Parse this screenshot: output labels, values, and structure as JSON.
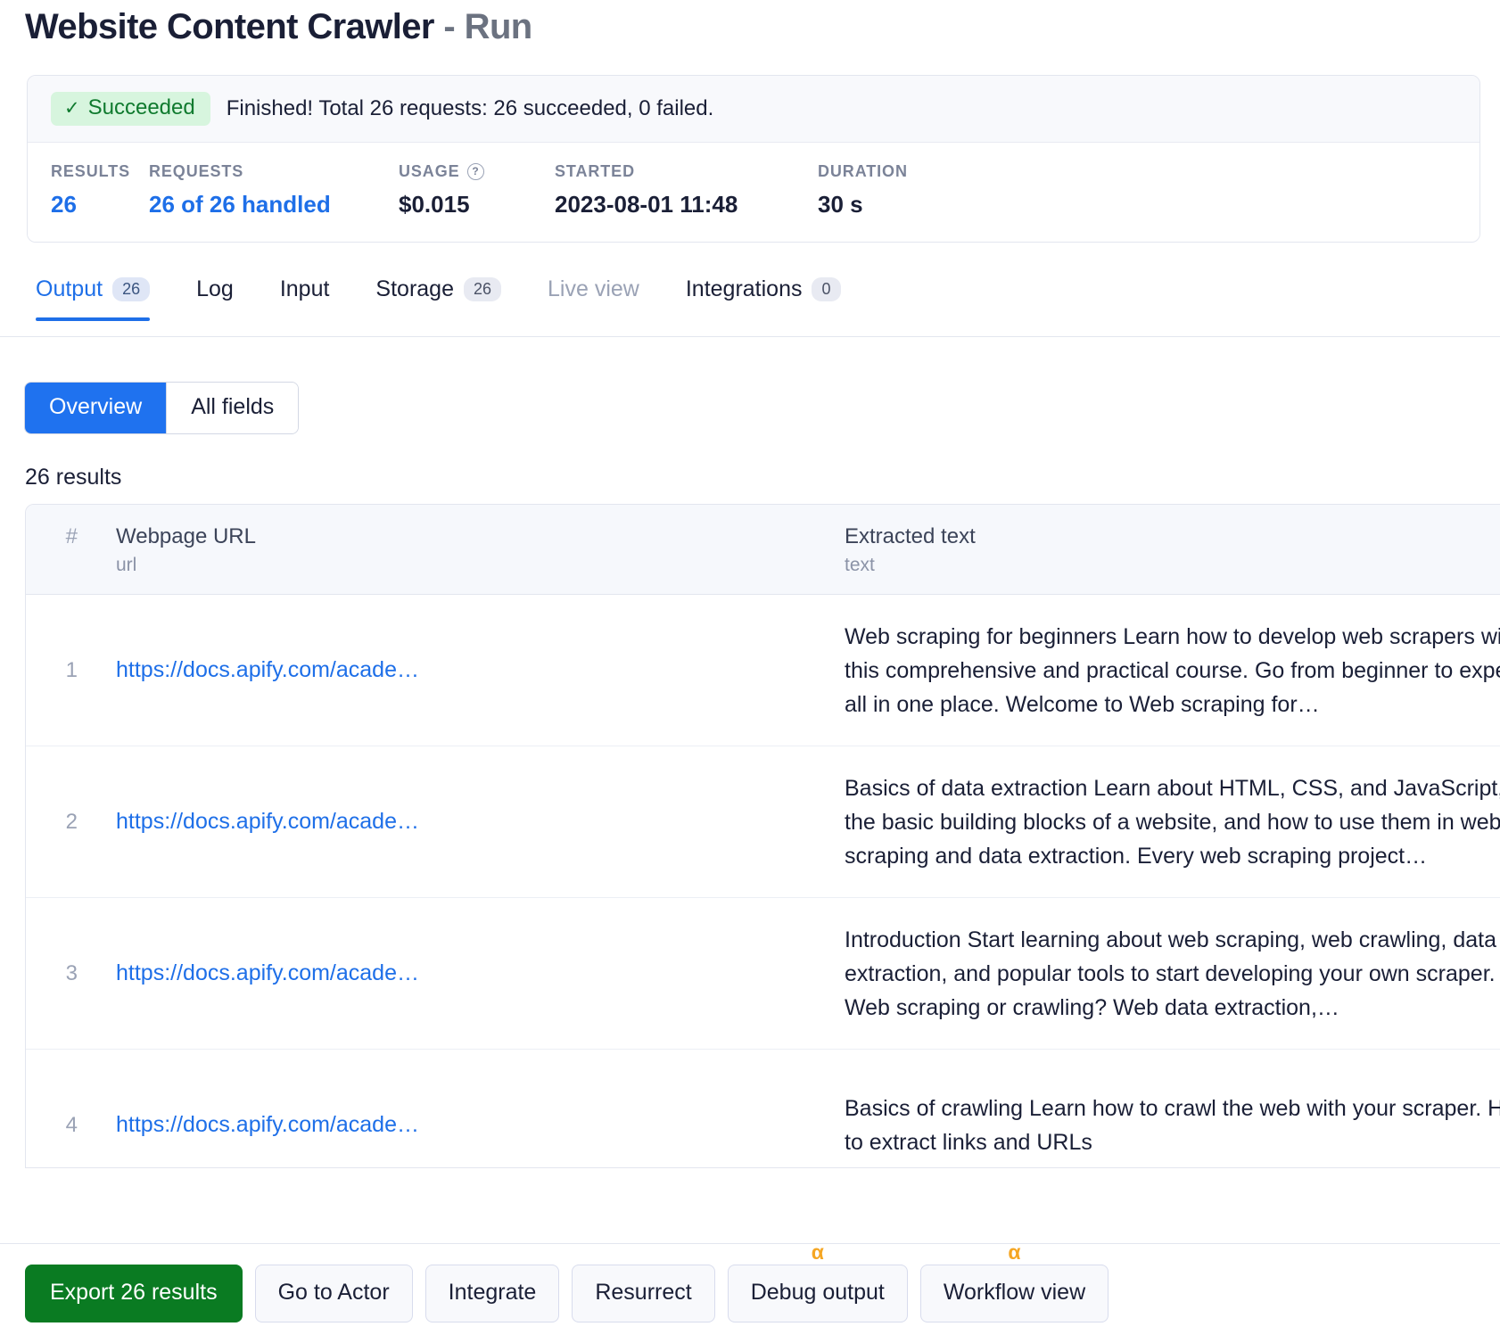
{
  "header": {
    "title_main": "Website Content Crawler",
    "title_separator": "-",
    "title_sub": "Run"
  },
  "status": {
    "badge_icon": "check-icon",
    "badge_label": "Succeeded",
    "message": "Finished! Total 26 requests: 26 succeeded, 0 failed.",
    "badge_bg": "#d7f5de",
    "badge_color": "#0f7a2e",
    "stats": [
      {
        "label": "RESULTS",
        "value": "26",
        "is_link": true
      },
      {
        "label": "REQUESTS",
        "value": "26 of 26 handled",
        "is_link": true
      },
      {
        "label": "USAGE",
        "value": "$0.015",
        "has_help_icon": true
      },
      {
        "label": "STARTED",
        "value": "2023-08-01 11:48"
      },
      {
        "label": "DURATION",
        "value": "30 s"
      }
    ]
  },
  "tabs": [
    {
      "label": "Output",
      "count": "26",
      "active": true
    },
    {
      "label": "Log",
      "count": null,
      "active": false
    },
    {
      "label": "Input",
      "count": null,
      "active": false
    },
    {
      "label": "Storage",
      "count": "26",
      "active": false
    },
    {
      "label": "Live view",
      "count": null,
      "active": false,
      "disabled": true
    },
    {
      "label": "Integrations",
      "count": "0",
      "active": false
    }
  ],
  "view_toggle": {
    "overview_label": "Overview",
    "all_fields_label": "All fields",
    "selected": "Overview",
    "active_color": "#1f72ef"
  },
  "results": {
    "count_text": "26 results",
    "columns": [
      {
        "title": "#",
        "sub": ""
      },
      {
        "title": "Webpage URL",
        "sub": "url"
      },
      {
        "title": "Extracted text",
        "sub": "text"
      }
    ],
    "rows": [
      {
        "index": "1",
        "url": "https://docs.apify.com/acade…",
        "text": "Web scraping for beginners Learn how to develop web scrapers with this comprehensive and practical course. Go from beginner to expert, all in one place. Welcome to Web scraping for…"
      },
      {
        "index": "2",
        "url": "https://docs.apify.com/acade…",
        "text": "Basics of data extraction Learn about HTML, CSS, and JavaScript, the basic building blocks of a website, and how to use them in web scraping and data extraction. Every web scraping project…"
      },
      {
        "index": "3",
        "url": "https://docs.apify.com/acade…",
        "text": "Introduction Start learning about web scraping, web crawling, data extraction, and popular tools to start developing your own scraper. Web scraping or crawling? Web data extraction,…"
      },
      {
        "index": "4",
        "url": "https://docs.apify.com/acade…",
        "text": "Basics of crawling Learn how to crawl the web with your scraper. How to extract links and URLs"
      }
    ]
  },
  "actions": [
    {
      "label": "Export 26 results",
      "primary": true,
      "alpha": false
    },
    {
      "label": "Go to Actor",
      "primary": false,
      "alpha": false
    },
    {
      "label": "Integrate",
      "primary": false,
      "alpha": false
    },
    {
      "label": "Resurrect",
      "primary": false,
      "alpha": false
    },
    {
      "label": "Debug output",
      "primary": false,
      "alpha": true,
      "alpha_glyph": "α"
    },
    {
      "label": "Workflow view",
      "primary": false,
      "alpha": true,
      "alpha_glyph": "α"
    }
  ]
}
